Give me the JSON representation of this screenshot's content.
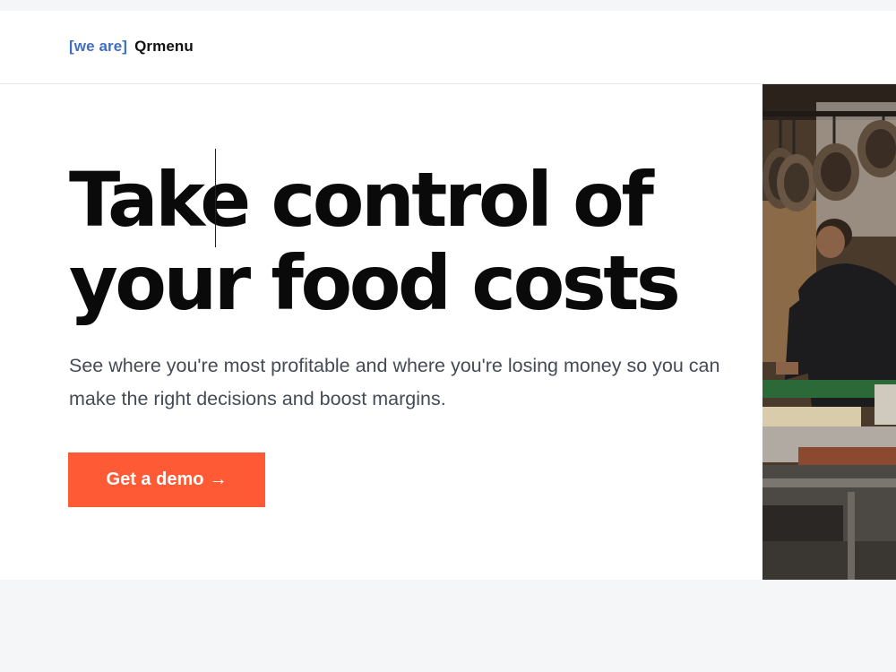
{
  "nav": {
    "brand_tag": "[we are]",
    "brand_name": "Qrmenu"
  },
  "hero": {
    "headline": "Take control of your food costs",
    "subtext": "See where you're most profitable and where you're losing money so you can make the right decisions and boost margins.",
    "cta_label": "Get a demo",
    "cta_arrow": "→",
    "image_alt": "Chef working in a restaurant kitchen with hanging pans"
  },
  "colors": {
    "accent": "#ff5a36",
    "brand_tag": "#3f6ec4",
    "text_primary": "#0a0a0a",
    "text_secondary": "#454b55"
  }
}
